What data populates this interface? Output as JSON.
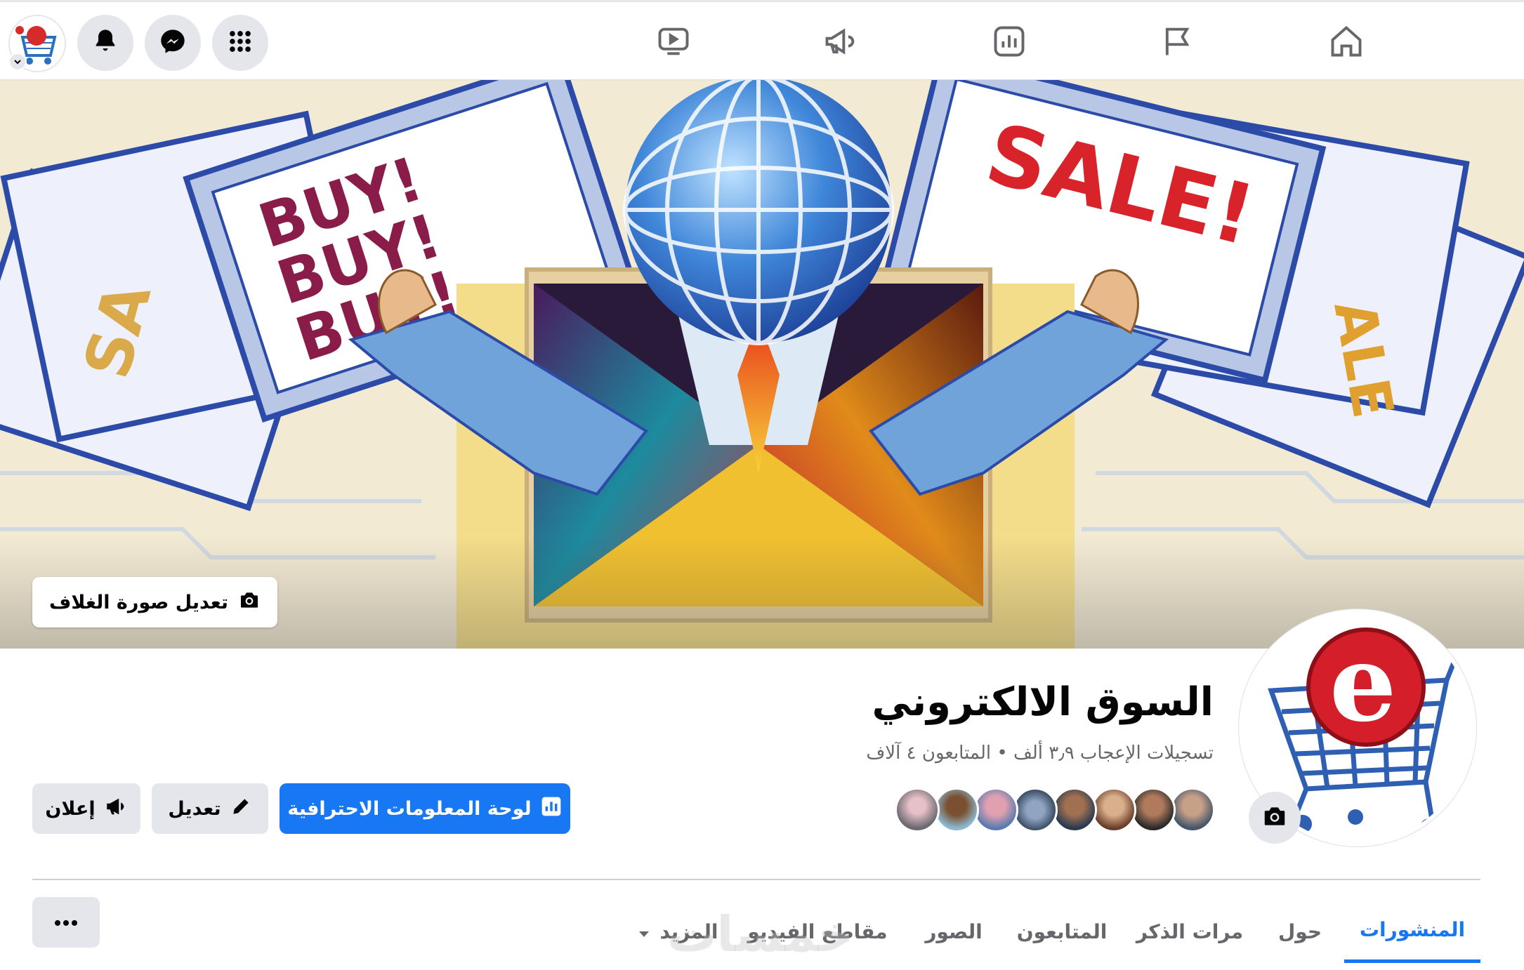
{
  "page": {
    "name": "السوق الالكتروني",
    "stats": "تسجيلات الإعجاب ٣٫٩ ألف • المتابعون ٤ آلاف"
  },
  "cover": {
    "edit_label": "تعديل صورة الغلاف",
    "signs": [
      "BUY!",
      "BUY!",
      "BUY!",
      "SALE!"
    ]
  },
  "actions": {
    "dashboard_label": "لوحة المعلومات الاحترافية",
    "edit_label": "تعديل",
    "ad_label": "إعلان"
  },
  "tabs": [
    {
      "label": "المنشورات",
      "active": true
    },
    {
      "label": "حول",
      "active": false
    },
    {
      "label": "مرات الذكر",
      "active": false
    },
    {
      "label": "المتابعون",
      "active": false
    },
    {
      "label": "الصور",
      "active": false
    },
    {
      "label": "مقاطع الفيديو",
      "active": false
    },
    {
      "label": "المزيد",
      "active": false
    }
  ],
  "watermark": "خمسات",
  "colors": {
    "accent": "#1877f2",
    "button_grey": "#e4e6eb",
    "secondary_text": "#65676b"
  },
  "icons": {
    "top_left": [
      "avatar",
      "bell-icon",
      "messenger-icon",
      "grid-menu-icon"
    ],
    "nav": [
      "watch-icon",
      "megaphone-icon",
      "insights-icon",
      "flag-icon",
      "home-icon"
    ]
  }
}
